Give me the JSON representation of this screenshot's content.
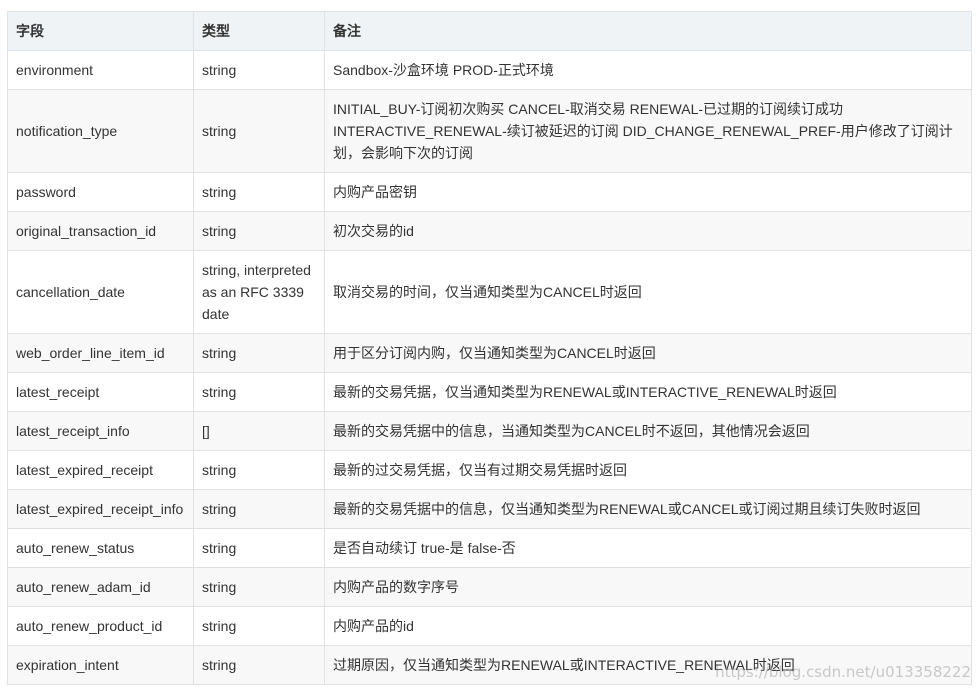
{
  "table": {
    "headers": [
      "字段",
      "类型",
      "备注"
    ],
    "rows": [
      {
        "field": "environment",
        "type": "string",
        "note": "Sandbox-沙盒环境 PROD-正式环境"
      },
      {
        "field": "notification_type",
        "type": "string",
        "note": "INITIAL_BUY-订阅初次购买 CANCEL-取消交易 RENEWAL-已过期的订阅续订成功 INTERACTIVE_RENEWAL-续订被延迟的订阅 DID_CHANGE_RENEWAL_PREF-用户修改了订阅计划，会影响下次的订阅"
      },
      {
        "field": "password",
        "type": "string",
        "note": "内购产品密钥"
      },
      {
        "field": "original_transaction_id",
        "type": "string",
        "note": "初次交易的id"
      },
      {
        "field": "cancellation_date",
        "type": "string, interpreted as an RFC 3339 date",
        "note": "取消交易的时间，仅当通知类型为CANCEL时返回"
      },
      {
        "field": "web_order_line_item_id",
        "type": "string",
        "note": "用于区分订阅内购，仅当通知类型为CANCEL时返回"
      },
      {
        "field": "latest_receipt",
        "type": "string",
        "note": "最新的交易凭据，仅当通知类型为RENEWAL或INTERACTIVE_RENEWAL时返回"
      },
      {
        "field": "latest_receipt_info",
        "type": "[]",
        "note": "最新的交易凭据中的信息，当通知类型为CANCEL时不返回，其他情况会返回"
      },
      {
        "field": "latest_expired_receipt",
        "type": "string",
        "note": "最新的过交易凭据，仅当有过期交易凭据时返回"
      },
      {
        "field": "latest_expired_receipt_info",
        "type": "string",
        "note": "最新的交易凭据中的信息，仅当通知类型为RENEWAL或CANCEL或订阅过期且续订失败时返回"
      },
      {
        "field": "auto_renew_status",
        "type": "string",
        "note": "是否自动续订 true-是 false-否"
      },
      {
        "field": "auto_renew_adam_id",
        "type": "string",
        "note": "内购产品的数字序号"
      },
      {
        "field": "auto_renew_product_id",
        "type": "string",
        "note": "内购产品的id"
      },
      {
        "field": "expiration_intent",
        "type": "string",
        "note": "过期原因，仅当通知类型为RENEWAL或INTERACTIVE_RENEWAL时返回"
      }
    ]
  },
  "watermark": "https://blog.csdn.net/u013358222"
}
